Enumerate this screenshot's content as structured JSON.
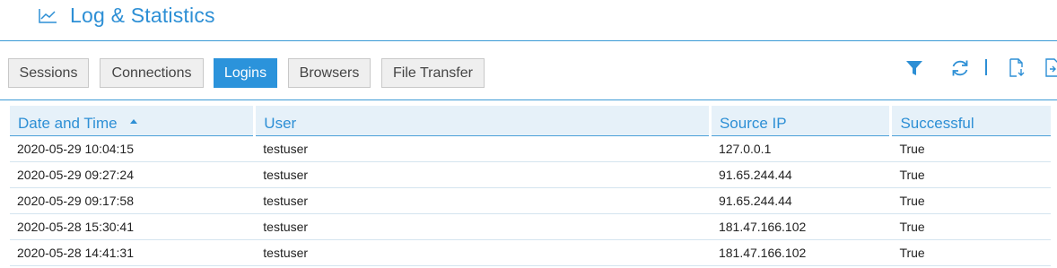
{
  "header": {
    "title": "Log & Statistics",
    "icon": "line-chart-icon"
  },
  "tabs": [
    {
      "label": "Sessions",
      "active": false
    },
    {
      "label": "Connections",
      "active": false
    },
    {
      "label": "Logins",
      "active": true
    },
    {
      "label": "Browsers",
      "active": false
    },
    {
      "label": "File Transfer",
      "active": false
    }
  ],
  "toolbar_icons": [
    "filter-icon",
    "refresh-icon",
    "export-icon",
    "export-alt-icon"
  ],
  "colors": {
    "accent": "#2b93db",
    "header_bg": "#e6f1f9",
    "tab_bg": "#efefef"
  },
  "table": {
    "columns": [
      "Date and Time",
      "User",
      "Source IP",
      "Successful"
    ],
    "sorted_column": "Date and Time",
    "sort_direction": "ascending",
    "rows": [
      [
        "2020-05-29 10:04:15",
        "testuser",
        "127.0.0.1",
        "True"
      ],
      [
        "2020-05-29 09:27:24",
        "testuser",
        "91.65.244.44",
        "True"
      ],
      [
        "2020-05-29 09:17:58",
        "testuser",
        "91.65.244.44",
        "True"
      ],
      [
        "2020-05-28 15:30:41",
        "testuser",
        "181.47.166.102",
        "True"
      ],
      [
        "2020-05-28 14:41:31",
        "testuser",
        "181.47.166.102",
        "True"
      ]
    ]
  }
}
